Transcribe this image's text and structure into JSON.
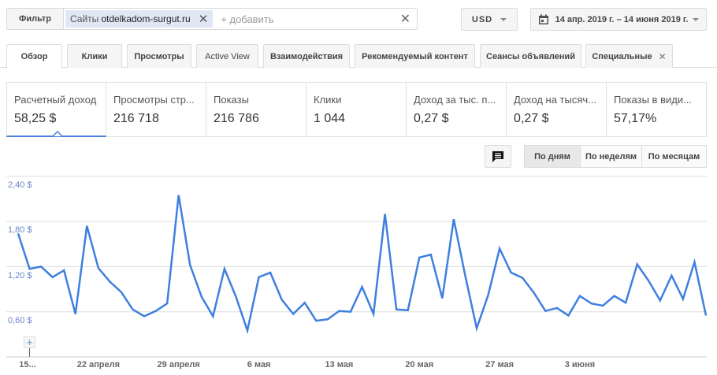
{
  "filter": {
    "label": "Фильтр",
    "chip_prefix": "Сайты",
    "chip_value": "otdelkadom-surgut.ru",
    "add_placeholder": "+ добавить"
  },
  "currency": "USD",
  "date_range": "14 апр. 2019 г. – 14 июня 2019 г.",
  "tabs": [
    {
      "label": "Обзор",
      "active": true
    },
    {
      "label": "Клики"
    },
    {
      "label": "Просмотры"
    },
    {
      "label": "Active View"
    },
    {
      "label": "Взаимодействия"
    },
    {
      "label": "Рекомендуемый контент"
    },
    {
      "label": "Сеансы объявлений"
    },
    {
      "label": "Специальные",
      "closable": true
    }
  ],
  "metrics": [
    {
      "label": "Расчетный доход",
      "value": "58,25 $",
      "selected": true
    },
    {
      "label": "Просмотры стр...",
      "value": "216 718"
    },
    {
      "label": "Показы",
      "value": "216 786"
    },
    {
      "label": "Клики",
      "value": "1 044"
    },
    {
      "label": "Доход за тыс. п...",
      "value": "0,27 $"
    },
    {
      "label": "Доход на тысяч...",
      "value": "0,27 $"
    },
    {
      "label": "Показы в види...",
      "value": "57,17%"
    }
  ],
  "granularity": {
    "day": "По дням",
    "week": "По неделям",
    "month": "По месяцам",
    "selected": "day"
  },
  "colors": {
    "accent": "#4a7fdc",
    "line": "#3f7fe0"
  },
  "chart_data": {
    "type": "line",
    "ylim": [
      0,
      2.4
    ],
    "y_ticks": [
      "2,40 $",
      "1,80 $",
      "1,20 $",
      "0,60 $"
    ],
    "y_tick_values": [
      2.4,
      1.8,
      1.2,
      0.6
    ],
    "x_tick_labels": [
      {
        "index": 0,
        "label": "15..."
      },
      {
        "index": 7,
        "label": "22 апреля"
      },
      {
        "index": 14,
        "label": "29 апреля"
      },
      {
        "index": 21,
        "label": "6 мая"
      },
      {
        "index": 28,
        "label": "13 мая"
      },
      {
        "index": 35,
        "label": "20 мая"
      },
      {
        "index": 42,
        "label": "27 мая"
      },
      {
        "index": 49,
        "label": "3 июня"
      }
    ],
    "grid": true,
    "series": [
      {
        "values": [
          1.64,
          1.17,
          1.2,
          1.06,
          1.15,
          0.57,
          1.74,
          1.18,
          1.0,
          0.86,
          0.63,
          0.54,
          0.61,
          0.71,
          2.15,
          1.22,
          0.8,
          0.54,
          1.17,
          0.8,
          0.35,
          1.06,
          1.12,
          0.76,
          0.57,
          0.72,
          0.48,
          0.5,
          0.61,
          0.6,
          0.93,
          0.57,
          1.9,
          0.63,
          0.62,
          1.32,
          1.36,
          0.78,
          1.83,
          1.08,
          0.38,
          0.82,
          1.44,
          1.12,
          1.05,
          0.85,
          0.61,
          0.65,
          0.55,
          0.81,
          0.71,
          0.68,
          0.81,
          0.72,
          1.23,
          1.01,
          0.75,
          1.08,
          0.77,
          1.26,
          0.55
        ]
      }
    ]
  }
}
